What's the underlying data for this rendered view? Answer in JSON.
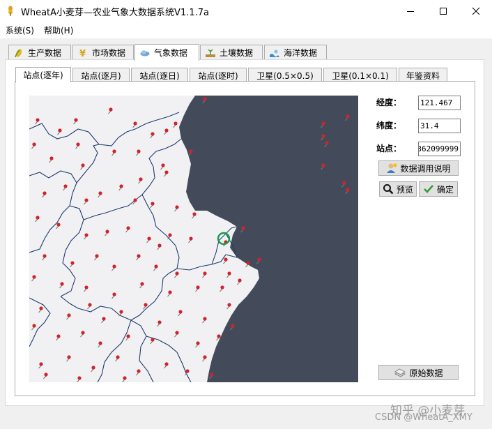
{
  "window": {
    "title": "WheatA小麦芽—农业气象大数据系统V1.1.7a",
    "controls": [
      "minimize",
      "maximize",
      "close"
    ]
  },
  "menu": {
    "items": [
      {
        "label": "系统(S)"
      },
      {
        "label": "帮助(H)"
      }
    ]
  },
  "main_tabs": [
    {
      "label": "生产数据",
      "icon": "corn-icon"
    },
    {
      "label": "市场数据",
      "icon": "yen-icon"
    },
    {
      "label": "气象数据",
      "icon": "cloud-icon",
      "active": true
    },
    {
      "label": "土壤数据",
      "icon": "soil-icon"
    },
    {
      "label": "海洋数据",
      "icon": "ocean-icon"
    }
  ],
  "sub_tabs": [
    {
      "label": "站点(逐年)",
      "active": true
    },
    {
      "label": "站点(逐月)"
    },
    {
      "label": "站点(逐日)"
    },
    {
      "label": "站点(逐时)"
    },
    {
      "label": "卫星(0.5×0.5)"
    },
    {
      "label": "卫星(0.1×0.1)"
    },
    {
      "label": "年鉴资料"
    }
  ],
  "form": {
    "longitude_label": "经度：",
    "longitude_value": "121.467",
    "latitude_label": "纬度：",
    "latitude_value": "31.4",
    "station_label": "站点：",
    "station_value": "362099999"
  },
  "buttons": {
    "help": "数据调用说明",
    "preview": "预览",
    "confirm": "确定",
    "raw_data": "原始数据"
  },
  "map": {
    "land_color": "#f1f1f3",
    "sea_color": "#434b5b",
    "boundary_color": "#1f3a6e",
    "marker_color": "#d0232b",
    "selection_color": "#17a04b"
  },
  "watermark": {
    "line1": "知乎 @小麦芽",
    "line2": "CSDN @WheatA_XMY"
  }
}
